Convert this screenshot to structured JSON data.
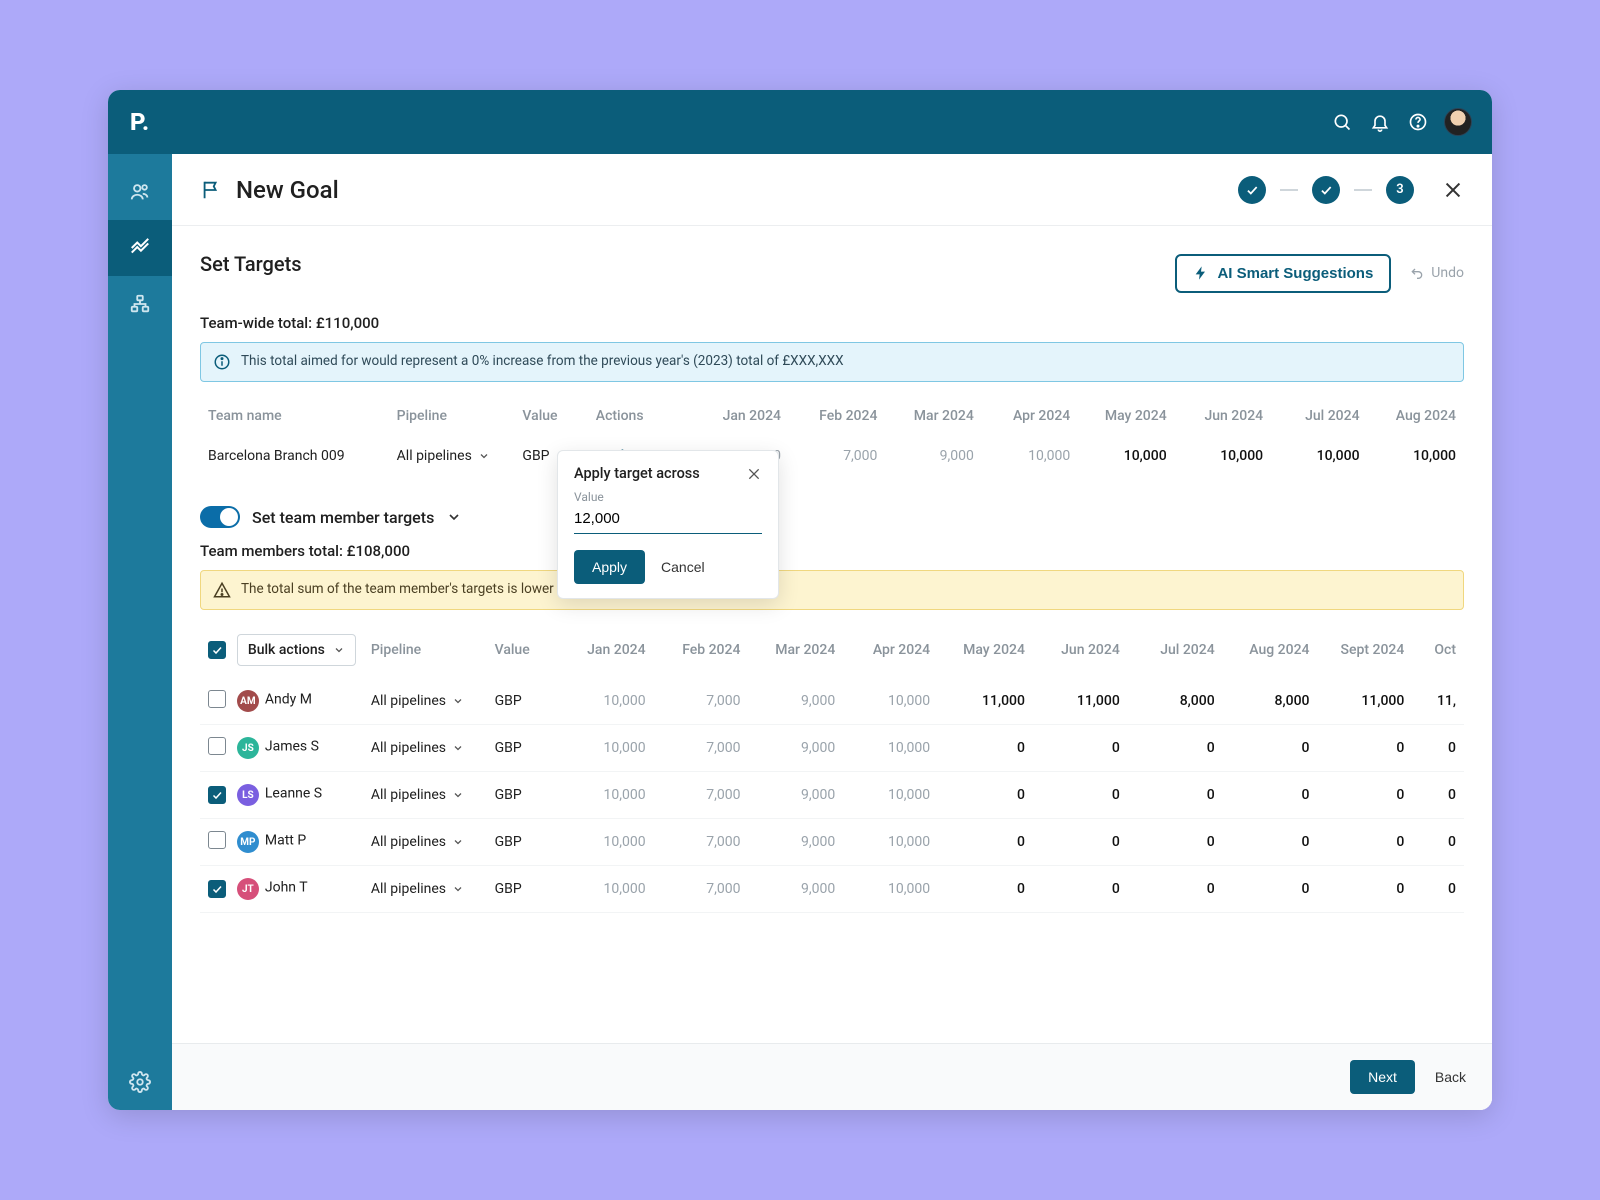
{
  "header": {
    "logo": "P.",
    "page_title": "New Goal",
    "step_current_number": "3"
  },
  "section": {
    "set_targets_title": "Set Targets",
    "ai_button": "AI Smart Suggestions",
    "undo": "Undo",
    "team_wide_total_label": "Team-wide total: £110,000",
    "info_banner": "This total aimed for would represent a 0% increase from the previous year's (2023) total of £XXX,XXX"
  },
  "team_table": {
    "columns": {
      "team_name": "Team name",
      "pipeline": "Pipeline",
      "value": "Value",
      "actions": "Actions",
      "months": [
        "Jan 2024",
        "Feb 2024",
        "Mar 2024",
        "Apr 2024",
        "May 2024",
        "Jun 2024",
        "Jul 2024",
        "Aug 2024"
      ]
    },
    "row": {
      "team_name": "Barcelona Branch 009",
      "pipeline": "All pipelines",
      "value": "GBP",
      "action": "Apply across",
      "months_muted": [
        "10,000",
        "7,000",
        "9,000",
        "10,000"
      ],
      "months_strong": [
        "10,000",
        "10,000",
        "10,000",
        "10,000"
      ]
    }
  },
  "popover": {
    "title": "Apply target across",
    "label": "Value",
    "value": "12,000",
    "apply": "Apply",
    "cancel": "Cancel"
  },
  "member_section": {
    "toggle_label": "Set team member targets",
    "members_total_label": "Team members total: £108,000",
    "warn_banner": "The total sum of the team member's targets is lower than the team-wide goal",
    "bulk_actions": "Bulk actions"
  },
  "member_table": {
    "columns": {
      "pipeline": "Pipeline",
      "value": "Value",
      "months": [
        "Jan 2024",
        "Feb 2024",
        "Mar 2024",
        "Apr 2024",
        "May 2024",
        "Jun 2024",
        "Jul 2024",
        "Aug 2024",
        "Sept 2024",
        "Oct"
      ]
    },
    "rows": [
      {
        "checked": false,
        "initials": "AM",
        "color": "#a24b4b",
        "name": "Andy M",
        "pipeline": "All pipelines",
        "value": "GBP",
        "muted": [
          "10,000",
          "7,000",
          "9,000",
          "10,000"
        ],
        "strong": [
          "11,000",
          "11,000",
          "8,000",
          "8,000",
          "11,000",
          "11,"
        ]
      },
      {
        "checked": false,
        "initials": "JS",
        "color": "#2cb59a",
        "name": "James S",
        "pipeline": "All pipelines",
        "value": "GBP",
        "muted": [
          "10,000",
          "7,000",
          "9,000",
          "10,000"
        ],
        "strong": [
          "0",
          "0",
          "0",
          "0",
          "0",
          "0"
        ]
      },
      {
        "checked": true,
        "initials": "LS",
        "color": "#7a5fe0",
        "name": "Leanne S",
        "pipeline": "All pipelines",
        "value": "GBP",
        "muted": [
          "10,000",
          "7,000",
          "9,000",
          "10,000"
        ],
        "strong": [
          "0",
          "0",
          "0",
          "0",
          "0",
          "0"
        ]
      },
      {
        "checked": false,
        "initials": "MP",
        "color": "#2f8dcf",
        "name": "Matt P",
        "pipeline": "All pipelines",
        "value": "GBP",
        "muted": [
          "10,000",
          "7,000",
          "9,000",
          "10,000"
        ],
        "strong": [
          "0",
          "0",
          "0",
          "0",
          "0",
          "0"
        ]
      },
      {
        "checked": true,
        "initials": "JT",
        "color": "#d64f7a",
        "name": "John T",
        "pipeline": "All pipelines",
        "value": "GBP",
        "muted": [
          "10,000",
          "7,000",
          "9,000",
          "10,000"
        ],
        "strong": [
          "0",
          "0",
          "0",
          "0",
          "0",
          "0"
        ]
      }
    ]
  },
  "footer": {
    "next": "Next",
    "back": "Back"
  }
}
